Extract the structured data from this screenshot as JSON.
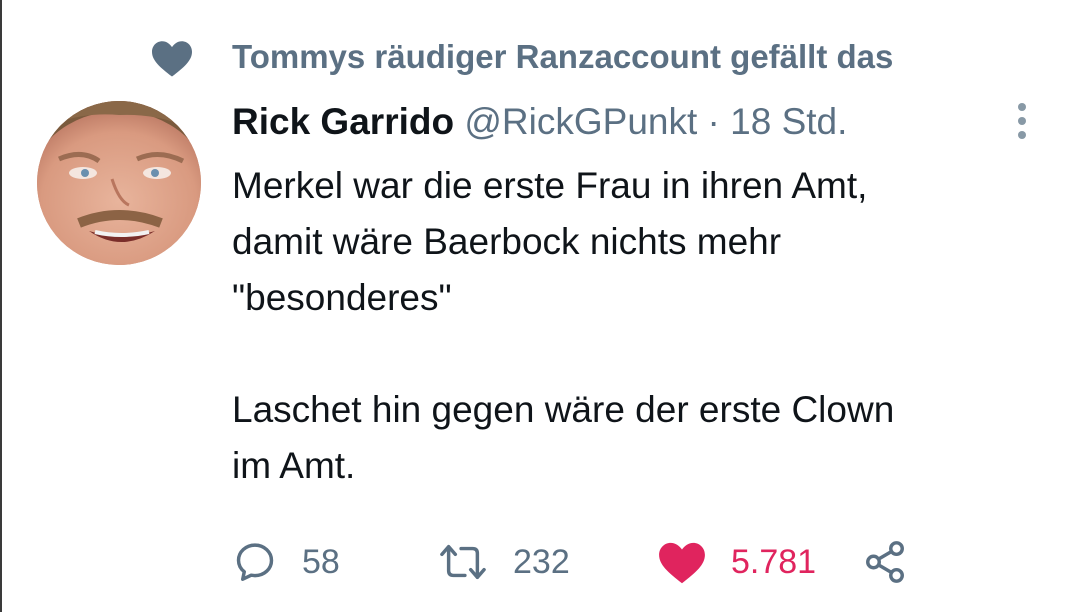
{
  "context": {
    "text": "Tommys räudiger Ranzaccount gefällt das",
    "icon": "heart-icon",
    "color": "#5b7083"
  },
  "tweet": {
    "author_name": "Rick Garrido",
    "author_handle": "@RickGPunkt",
    "separator": "·",
    "time": "18 Std.",
    "lines": [
      "Merkel war die erste Frau in ihren Amt,",
      "damit wäre Baerbock nichts mehr",
      "\"besonderes\"",
      "",
      "Laschet hin gegen wäre der erste Clown",
      "im Amt."
    ]
  },
  "actions": {
    "reply_count": "58",
    "retweet_count": "232",
    "like_count": "5.781",
    "icons": [
      "reply-icon",
      "retweet-icon",
      "heart-icon",
      "share-icon"
    ]
  },
  "colors": {
    "text": "#0f1419",
    "secondary": "#5b7083",
    "like": "#e0245e"
  }
}
